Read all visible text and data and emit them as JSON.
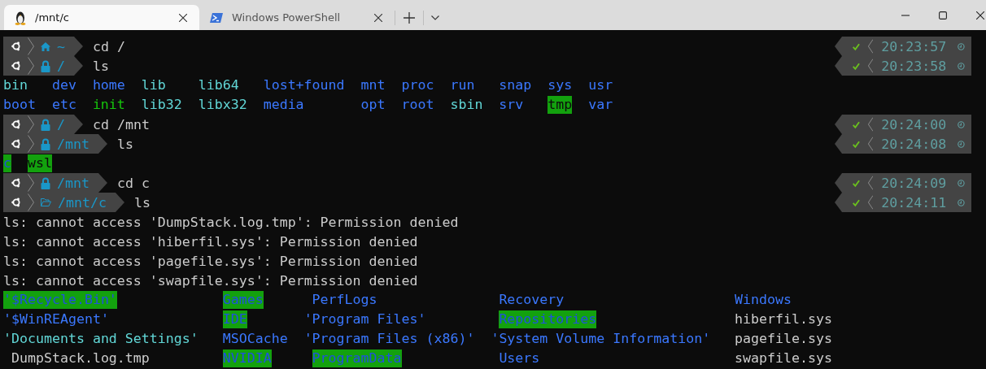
{
  "tabs": [
    {
      "title": "/mnt/c",
      "kind": "penguin",
      "selected": true
    },
    {
      "title": "Windows PowerShell",
      "kind": "shell",
      "selected": false
    }
  ],
  "lines": [
    {
      "kind": "prompt",
      "location": {
        "kind": "home",
        "path": "~"
      },
      "command": "cd /",
      "success": true,
      "time": "20:23:57"
    },
    {
      "kind": "prompt",
      "location": {
        "kind": "locked",
        "path": "/"
      },
      "command": "ls",
      "success": true,
      "time": "20:23:58"
    },
    {
      "kind": "listing",
      "columns": [
        [
          {
            "name": "bin",
            "kind": "link"
          },
          {
            "name": "boot",
            "kind": "dir"
          }
        ],
        [
          {
            "name": "dev",
            "kind": "dir"
          },
          {
            "name": "etc",
            "kind": "dir"
          }
        ],
        [
          {
            "name": "home",
            "kind": "dir"
          },
          {
            "name": "init",
            "kind": "exec"
          }
        ],
        [
          {
            "name": "lib",
            "kind": "link"
          },
          {
            "name": "lib32",
            "kind": "link"
          }
        ],
        [
          {
            "name": "lib64",
            "kind": "link"
          },
          {
            "name": "libx32",
            "kind": "link"
          }
        ],
        [
          {
            "name": "lost+found",
            "kind": "dir"
          },
          {
            "name": "media",
            "kind": "dir"
          }
        ],
        [
          {
            "name": "mnt",
            "kind": "dir"
          },
          {
            "name": "opt",
            "kind": "dir"
          }
        ],
        [
          {
            "name": "proc",
            "kind": "dir"
          },
          {
            "name": "root",
            "kind": "dir"
          }
        ],
        [
          {
            "name": "run",
            "kind": "dir"
          },
          {
            "name": "sbin",
            "kind": "link"
          }
        ],
        [
          {
            "name": "snap",
            "kind": "dir"
          },
          {
            "name": "srv",
            "kind": "dir"
          }
        ],
        [
          {
            "name": "sys",
            "kind": "dir"
          },
          {
            "name": "tmp",
            "kind": "sticky"
          }
        ],
        [
          {
            "name": "usr",
            "kind": "dir"
          },
          {
            "name": "var",
            "kind": "dir"
          }
        ]
      ]
    },
    {
      "kind": "prompt",
      "location": {
        "kind": "locked",
        "path": "/"
      },
      "command": "cd /mnt",
      "success": true,
      "time": "20:24:00"
    },
    {
      "kind": "prompt",
      "location": {
        "kind": "locked",
        "path": "/mnt"
      },
      "command": "ls",
      "success": true,
      "time": "20:24:08"
    },
    {
      "kind": "listing",
      "columns": [
        [
          {
            "name": "c",
            "kind": "writable"
          }
        ],
        [
          {
            "name": "wsl",
            "kind": "sticky"
          }
        ]
      ]
    },
    {
      "kind": "prompt",
      "location": {
        "kind": "locked",
        "path": "/mnt"
      },
      "command": "cd c",
      "success": true,
      "time": "20:24:09"
    },
    {
      "kind": "prompt",
      "location": {
        "kind": "folder",
        "path": "/mnt/c"
      },
      "command": "ls",
      "success": true,
      "time": "20:24:11"
    },
    {
      "kind": "output",
      "text": "ls: cannot access 'DumpStack.log.tmp': Permission denied"
    },
    {
      "kind": "output",
      "text": "ls: cannot access 'hiberfil.sys': Permission denied"
    },
    {
      "kind": "output",
      "text": "ls: cannot access 'pagefile.sys': Permission denied"
    },
    {
      "kind": "output",
      "text": "ls: cannot access 'swapfile.sys': Permission denied"
    },
    {
      "kind": "listing",
      "columns": [
        [
          {
            "name": "'$Recycle.Bin'",
            "kind": "writable"
          },
          {
            "name": "'$WinREAgent'",
            "kind": "dir"
          },
          {
            "name": "'Documents and Settings'",
            "kind": "link"
          },
          {
            "name": "DumpStack.log.tmp",
            "kind": "file"
          }
        ],
        [
          {
            "name": "Games",
            "kind": "writable"
          },
          {
            "name": "IDE",
            "kind": "writable"
          },
          {
            "name": "MSOCache",
            "kind": "dir"
          },
          {
            "name": "NVIDIA",
            "kind": "writable"
          }
        ],
        [
          {
            "name": "PerfLogs",
            "kind": "dir"
          },
          {
            "name": "'Program Files'",
            "kind": "dir"
          },
          {
            "name": "'Program Files (x86)'",
            "kind": "dir"
          },
          {
            "name": "ProgramData",
            "kind": "writable"
          }
        ],
        [
          {
            "name": "Recovery",
            "kind": "dir"
          },
          {
            "name": "Repositories",
            "kind": "writable"
          },
          {
            "name": "'System Volume Information'",
            "kind": "dir"
          },
          {
            "name": "Users",
            "kind": "dir"
          }
        ],
        [
          {
            "name": "Windows",
            "kind": "dir"
          },
          {
            "name": "hiberfil.sys",
            "kind": "file"
          },
          {
            "name": "pagefile.sys",
            "kind": "file"
          },
          {
            "name": "swapfile.sys",
            "kind": "file"
          }
        ]
      ]
    }
  ]
}
